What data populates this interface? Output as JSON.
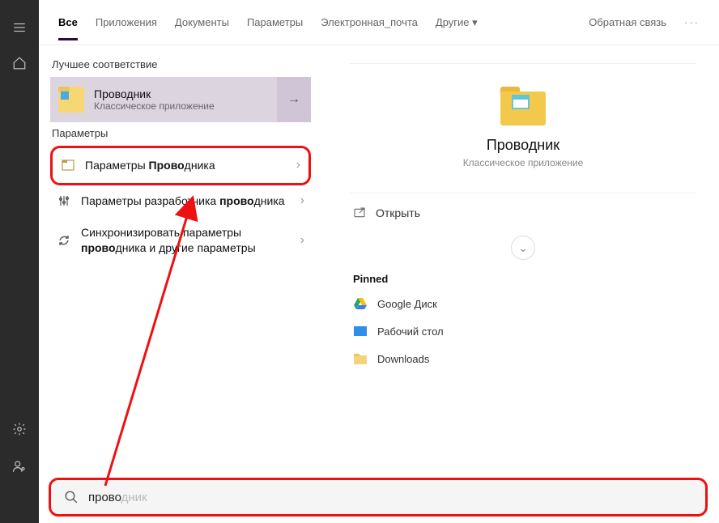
{
  "tabs": {
    "all": "Все",
    "apps": "Приложения",
    "docs": "Документы",
    "settings": "Параметры",
    "email": "Электронная_почта",
    "more": "Другие",
    "feedback": "Обратная связь"
  },
  "sections": {
    "best_match": "Лучшее соответствие",
    "parameters": "Параметры"
  },
  "best_match": {
    "title": "Проводник",
    "subtitle": "Классическое приложение"
  },
  "params": [
    {
      "prefix": "Параметры ",
      "bold": "Прово",
      "suffix": "дника"
    },
    {
      "prefix": "Параметры разработчика ",
      "bold": "прово",
      "suffix": "дника"
    },
    {
      "prefix": "Синхронизировать параметры ",
      "bold": "прово",
      "suffix": "дника и другие параметры"
    }
  ],
  "preview": {
    "title": "Проводник",
    "subtitle": "Классическое приложение",
    "open": "Открыть",
    "pinned_header": "Pinned",
    "pinned": [
      {
        "label": "Google Диск"
      },
      {
        "label": "Рабочий стол"
      },
      {
        "label": "Downloads"
      }
    ]
  },
  "search": {
    "typed": "прово",
    "ghost": "дник"
  }
}
